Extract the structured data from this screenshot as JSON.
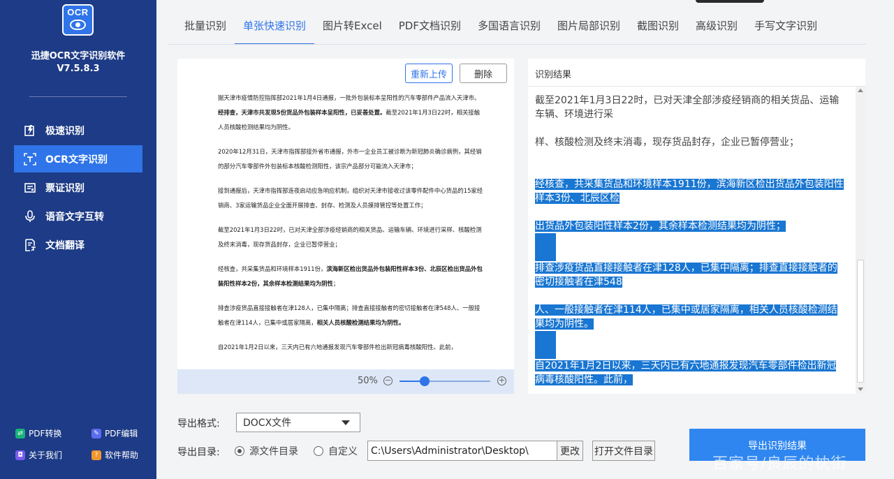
{
  "app": {
    "logo_text": "OCR",
    "name": "迅捷OCR文字识别软件",
    "version": "V7.5.8.3"
  },
  "sidebar": {
    "items": [
      {
        "label": "极速识别",
        "icon": "lightning-doc-icon"
      },
      {
        "label": "OCR文字识别",
        "icon": "scan-text-icon",
        "active": true
      },
      {
        "label": "票证识别",
        "icon": "ticket-icon"
      },
      {
        "label": "语音文字互转",
        "icon": "microphone-icon"
      },
      {
        "label": "文档翻译",
        "icon": "translate-doc-icon"
      }
    ],
    "bottom_links": [
      {
        "label": "PDF转换",
        "color": "#19b37a"
      },
      {
        "label": "PDF编辑",
        "color": "#5b6cf0"
      },
      {
        "label": "关于我们",
        "color": "#7a5af0"
      },
      {
        "label": "软件帮助",
        "color": "#f0962e"
      }
    ]
  },
  "tabs": [
    "批量识别",
    "单张快速识别",
    "图片转Excel",
    "PDF文档识别",
    "多国语言识别",
    "图片局部识别",
    "截图识别",
    "高级识别",
    "手写文字识别"
  ],
  "active_tab": 1,
  "preview": {
    "reupload_label": "重新上传",
    "delete_label": "删除",
    "paragraphs": [
      {
        "normal1": "据天津市疫情防控指挥部2021年1月4日通报，一批外包装标本呈阳性的汽车零部件产品流入天津市。",
        "bold": "经排查，天津市共发现5份货品外包装样本呈阳性，已妥善处置。",
        "normal2": "截至2021年1月3日22时，相关接触人员核酸检测结果均为阴性。"
      },
      {
        "normal1": "2020年12月31日，天津市指挥部接外省市通报，外市一企业员工被诊断为新冠肺炎确诊病例，其经销的部分汽车零部件外包装标本核酸检测阳性，该宗产品部分可能流入天津市；",
        "bold": "",
        "normal2": ""
      },
      {
        "normal1": "接到通报后，天津市指挥部连夜启动应急响应机制，组织对天津市接收过该零件配件中心货品的15家经销商、3家运输货品企业全面开展排查、封存、检测及人员摸排管控等处置工作；",
        "bold": "",
        "normal2": ""
      },
      {
        "normal1": "截至2021年1月3日22时，已对天津全部涉疫经销商的相关货品、运输车辆、环境进行采样、核酸检测及终末消毒，现存货品封存，企业已暂停营业；",
        "bold": "",
        "normal2": ""
      },
      {
        "normal1": "经核查，共采集货品和环境样本1911份，",
        "bold": "滨海新区检出货品外包装阳性样本3份、北辰区检出货品外包装阳性样本2份，其余样本检测结果均为阴性",
        "normal2": "；"
      },
      {
        "normal1": "排查涉疫货品直接接触者在津128人，已集中隔离；排查直接接触者的密切接触者在津548人、一般接触者在津114人，已集中或居家隔离，",
        "bold": "相关人员核酸检测结果均为阴性。",
        "normal2": ""
      },
      {
        "normal1": "自2021年1月2日以来，三天内已有六地通报发现汽车零部件检出新冠病毒核酸阳性。此前，",
        "bold": "",
        "normal2": ""
      }
    ],
    "zoom": {
      "value_label": "50%",
      "level": 0.28,
      "minus": "−",
      "plus": "+"
    }
  },
  "result": {
    "title": "识别结果",
    "plain_lines": [
      "截至2021年1月3日22时，已对天津全部涉疫经销商的相关货品、运输车辆、环境进行采",
      "样、核酸检测及终末消毒，现存货品封存，企业已暂停营业；"
    ],
    "highlighted_blocks": [
      "经核查，共采集货品和环境样本1911份，滨海新区检出货品外包装阳性样本3份、北辰区检",
      "出货品外包装阳性样本2份，其余样本检测结果均为阴性；",
      "排查涉疫货品直接接触者在津128人，已集中隔离；排查直接接触者的密切接触者在津548",
      "人、一般接触者在津114人，已集中或居家隔离，相关人员核酸检测结果均为阴性。",
      "自2021年1月2日以来，三天内已有六地通报发现汽车零部件检出新冠病毒核酸阳性。此前，"
    ]
  },
  "export": {
    "format_label": "导出格式:",
    "format_value": "DOCX文件",
    "dir_label": "导出目录:",
    "radio_source": "源文件目录",
    "radio_custom": "自定义",
    "path_value": "C:\\Users\\Administrator\\Desktop\\",
    "change_label": "更改",
    "open_label": "打开文件目录",
    "export_button": "导出识别结果"
  },
  "watermark": "百家号/良辰的枕街",
  "colors": {
    "sidebar_bg": "#1d3b86",
    "accent": "#2f74e8",
    "highlight": "#1976d2"
  }
}
